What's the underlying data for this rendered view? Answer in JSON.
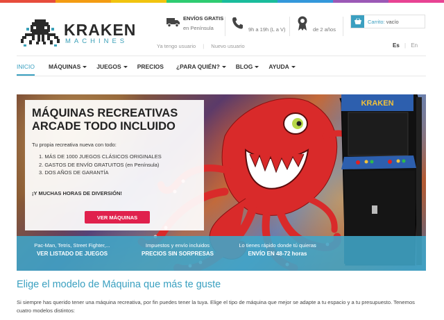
{
  "brand": {
    "name": "KRAKEN",
    "subtitle": "MACHINES",
    "strip_colors": [
      "#e74c3c",
      "#f39c12",
      "#f1c40f",
      "#2ecc71",
      "#1abc9c",
      "#3498db",
      "#9b59b6",
      "#e84393"
    ],
    "accent": "#3aa0c0",
    "cta_color": "#e0214d"
  },
  "header": {
    "shipping_title": "ENVÍOS GRATIS",
    "shipping_sub": "en Península",
    "phone_text": "9h a 19h (L a V)",
    "warranty_text": "de 2 años",
    "cart_label": "Carrito:",
    "cart_value": "vacío",
    "user_links": [
      "Ya tengo usuario",
      "Nuevo usuario"
    ],
    "languages": [
      "Es",
      "En"
    ]
  },
  "nav": [
    {
      "label": "INICIO",
      "active": true,
      "dropdown": false
    },
    {
      "label": "MÁQUINAS",
      "active": false,
      "dropdown": true
    },
    {
      "label": "JUEGOS",
      "active": false,
      "dropdown": true
    },
    {
      "label": "PRECIOS",
      "active": false,
      "dropdown": false
    },
    {
      "label": "¿PARA QUIÉN?",
      "active": false,
      "dropdown": true
    },
    {
      "label": "BLOG",
      "active": false,
      "dropdown": true
    },
    {
      "label": "AYUDA",
      "active": false,
      "dropdown": true
    }
  ],
  "hero": {
    "title_line1": "MÁQUINAS RECREATIVAS",
    "title_line2": "ARCADE TODO INCLUIDO",
    "lead": "Tu propia recreativa nueva con todo:",
    "list": [
      "1. MÁS DE 1000 JUEGOS CLÁSICOS ORIGINALES",
      "2. GASTOS DE ENVÍO GRATUITOS (en Península)",
      "3. DOS AÑOS DE GARANTÍA"
    ],
    "extra": "¡Y MUCHAS HORAS DE DIVERSIÓN!",
    "button": "VER MÁQUINAS",
    "cabinet_marquee": "KRAKEN",
    "features": [
      {
        "line1": "Pac-Man, Tetris, Street Fighter,...",
        "line2": "VER LISTADO DE JUEGOS"
      },
      {
        "line1": "Impuestos y envío incluidos",
        "line2": "PRECIOS SIN SORPRESAS"
      },
      {
        "line1": "Lo tienes rápido donde tú quieras",
        "line2": "ENVÍO EN 48-72 horas"
      }
    ]
  },
  "content": {
    "heading": "Elige el modelo de Máquina que más te guste",
    "paragraph": "Si siempre has querido tener una máquina recreativa, por fin puedes tener la tuya. Elige el tipo de máquina que mejor se adapte a tu espacio y a tu presupuesto. Tenemos cuatro modelos distintos:"
  }
}
